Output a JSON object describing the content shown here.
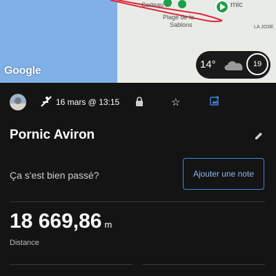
{
  "map": {
    "labels": [
      "Corteau",
      "Plage de la",
      "Sablons",
      "rnic",
      "LA JOSE"
    ],
    "logo_text": "Google"
  },
  "weather": {
    "temperature": "14°",
    "wind_speed": "19"
  },
  "activity": {
    "date": "16 mars @ 13:15",
    "title": "Pornic Aviron",
    "note_prompt": "Ça s'est bien passé?",
    "add_note_label": "Ajouter une note",
    "distance_value": "18 669,86",
    "distance_unit": "m",
    "distance_label": "Distance"
  },
  "colors": {
    "route": "#e0243a",
    "accent": "#3f86e0",
    "background": "#141414",
    "water": "#7fb0e8",
    "marker_green": "#1e9e48"
  }
}
